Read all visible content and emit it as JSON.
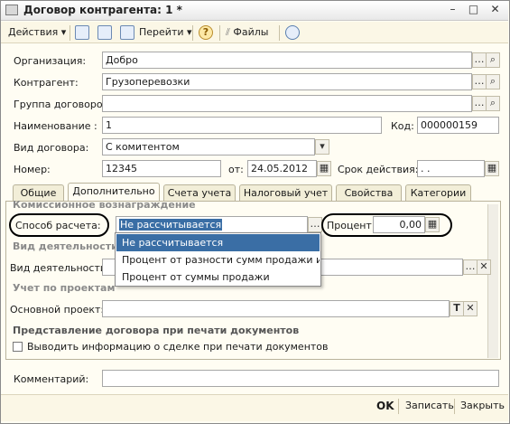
{
  "window": {
    "title": "Договор контрагента: 1 *"
  },
  "toolbar": {
    "actions": "Действия",
    "go": "Перейти",
    "help": "?",
    "files": "Файлы"
  },
  "form": {
    "org_label": "Организация:",
    "org_value": "Добро",
    "contractor_label": "Контрагент:",
    "contractor_value": "Грузоперевозки",
    "group_label": "Группа договоров:",
    "group_value": "",
    "name_label": "Наименование :",
    "name_value": "1",
    "code_label": "Код:",
    "code_value": "000000159",
    "type_label": "Вид договора:",
    "type_value": "С комитентом",
    "number_label": "Номер:",
    "number_value": "12345",
    "from_label": "от:",
    "from_value": "24.05.2012",
    "validity_label": "Срок действия:",
    "validity_value": " .  .",
    "comment_label": "Комментарий:",
    "comment_value": ""
  },
  "tabs": [
    {
      "label": "Общие"
    },
    {
      "label": "Дополнительно"
    },
    {
      "label": "Счета учета"
    },
    {
      "label": "Налоговый учет"
    },
    {
      "label": "Свойства"
    },
    {
      "label": "Категории"
    }
  ],
  "panel": {
    "section_commission": "Комиссионное вознаграждение",
    "calc_label": "Способ расчета:",
    "calc_value": "Не рассчитывается",
    "percent_label": "Процент:",
    "percent_value": "0,00",
    "section_activity": "Вид деятельности д",
    "activity_label": "Вид деятельности:",
    "activity_value": "",
    "section_projects": "Учет по проектам",
    "project_label": "Основной проект:",
    "project_value": "",
    "section_print": "Представление договора при печати документов",
    "print_checkbox": "Выводить информацию о сделке при печати документов"
  },
  "dropdown": {
    "options": [
      "Не рассчитывается",
      "Процент от разности сумм продажи и по...",
      "Процент от суммы продажи"
    ],
    "selected_index": 0
  },
  "footer": {
    "ok": "OK",
    "save": "Записать",
    "close": "Закрыть"
  }
}
